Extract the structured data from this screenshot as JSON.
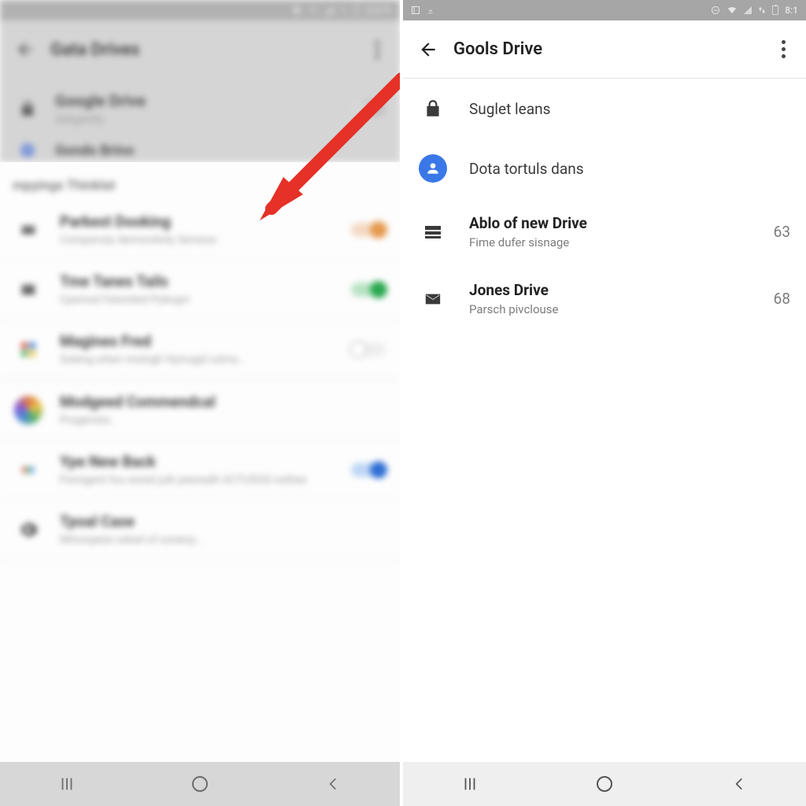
{
  "left": {
    "status": {
      "battery": "0.21%"
    },
    "app_title": "Gata Drives",
    "header_items": [
      {
        "title": "Google Drive",
        "subtitle": "Subgenlfy"
      },
      {
        "title": "Gondo Brino",
        "subtitle": ""
      }
    ],
    "sheet": {
      "section_title": "mpyings Thinklat",
      "rows": [
        {
          "title": "Parkest Dooking",
          "subtitle": "Compensly demondsity Semess",
          "switch": "orange"
        },
        {
          "title": "Tme Tanes Tails",
          "subtitle": "Cpennal Felonited Pyleupn",
          "switch": "green"
        },
        {
          "title": "Magines Fred",
          "subtitle": "Soleng when mistrgh Hymsgd rutms…",
          "switch": "grey"
        },
        {
          "title": "Modgeed Commendcal",
          "subtitle": "Progensto.",
          "switch": ""
        },
        {
          "title": "Ype New Back",
          "subtitle": "Psmigent fou esred juik peenedh ACTUSOS nsthes",
          "switch": "blue"
        },
        {
          "title": "Tpoal Case",
          "subtitle": "Minonpeen edoel of soneny…",
          "switch": ""
        }
      ]
    }
  },
  "right": {
    "status": {
      "time": "8:1"
    },
    "app_title": "Gools Drive",
    "items": [
      {
        "icon": "lock",
        "title": "Suglet leans",
        "subtitle": "",
        "value": "",
        "bold": false
      },
      {
        "icon": "person",
        "title": "Dota tortuls dans",
        "subtitle": "",
        "value": "",
        "bold": false
      },
      {
        "icon": "storage",
        "title": "Ablo of new Drive",
        "subtitle": "Fime dufer sisnage",
        "value": "63",
        "bold": true
      },
      {
        "icon": "mail",
        "title": "Jones Drive",
        "subtitle": "Parsch pivclouse",
        "value": "68",
        "bold": true
      }
    ]
  },
  "colors": {
    "arrow": "#e53127",
    "person_bg": "#3b78e7"
  }
}
